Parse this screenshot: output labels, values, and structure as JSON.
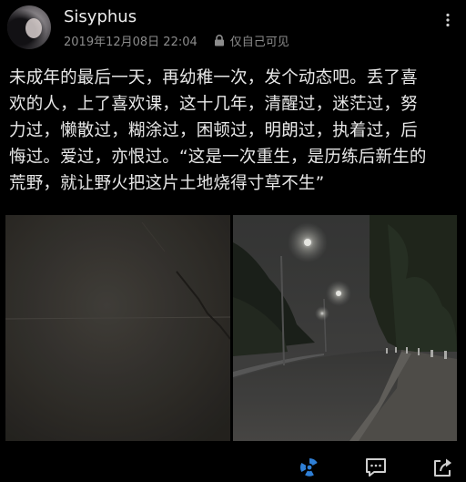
{
  "post": {
    "username": "Sisyphus",
    "timestamp": "2019年12月08日 22:04",
    "visibility": "仅自己可见",
    "text_lines": [
      "未成年的最后一天，再幼稚一次，发个动态吧。丢了喜",
      "欢的人，上了喜欢课，这十几年，清醒过，迷茫过，努",
      "力过，懒散过，糊涂过，困顿过，明朗过，执着过，后",
      "悔过。爱过，亦恨过。“这是一次重生，是历练后新生的",
      "荒野，就让野火把这片土地烧得寸草不生”"
    ]
  },
  "icons": {
    "visibility": "lock-icon",
    "more": "more-icon",
    "like": "radiation-icon",
    "comment": "comment-icon",
    "share": "share-icon"
  },
  "colors": {
    "background": "#000000",
    "text": "#e8e8e8",
    "meta": "#8c8c8c",
    "like_icon": "#2f7fd6"
  }
}
